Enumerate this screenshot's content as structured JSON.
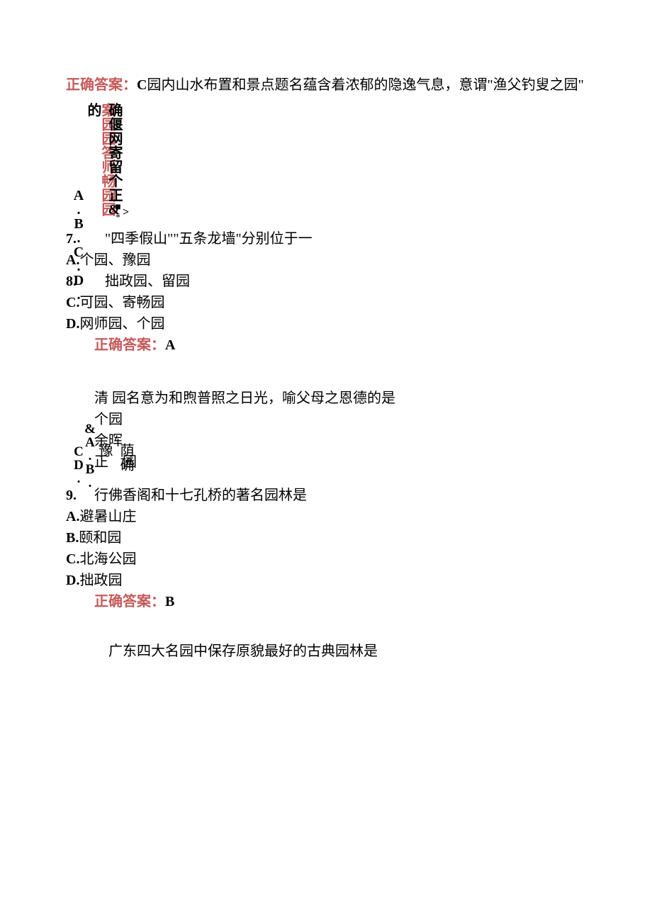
{
  "answer1": {
    "label": "正确答案：",
    "letter": "C",
    "text": "园内山水布置和景点题名蕴含着浓郁的隐逸气息，意谓\"渔父钓叟之园\""
  },
  "garbled1": {
    "col_red": "案园园答师畅园园",
    "col_black": "确偃网寄留个正&的",
    "col_abc": "A.B.C.D.",
    "mark": "■*",
    "arrow": ">"
  },
  "q7": {
    "num": "7.",
    "text": "\"四季假山\"\"五条龙墙\"分别位于一",
    "optA_label": "A.",
    "optA": "个园、豫园",
    "num8": "8.",
    "optB": "拙政园、留园",
    "optC_label": "C.",
    "optC": "可园、寄畅园",
    "optD_label": "D.",
    "optD": "网师园、个园",
    "ans_label": "正确答案：",
    "ans": "A"
  },
  "garbled2": {
    "line1_a": "清",
    "line1_b": "园名意为和煦普照之日光，喻父母之恩德的是",
    "line2": "个园",
    "line3": "余晖",
    "line4_a": "正",
    "line4_b": "园",
    "vcol1": "&A.B.",
    "vcol2": "CD.",
    "t_col": "荫确豫"
  },
  "q9": {
    "num": "9.",
    "text": "行佛香阁和十七孔桥的著名园林是",
    "optA_label": "A.",
    "optA": "避暑山庄",
    "optB_label": "B.",
    "optB": "颐和园",
    "optC_label": "C.",
    "optC": "北海公园",
    "optD_label": "D.",
    "optD": "拙政园",
    "ans_label": "正确答案：",
    "ans": "B"
  },
  "q10": {
    "text": "广东四大名园中保存原貌最好的古典园林是"
  }
}
